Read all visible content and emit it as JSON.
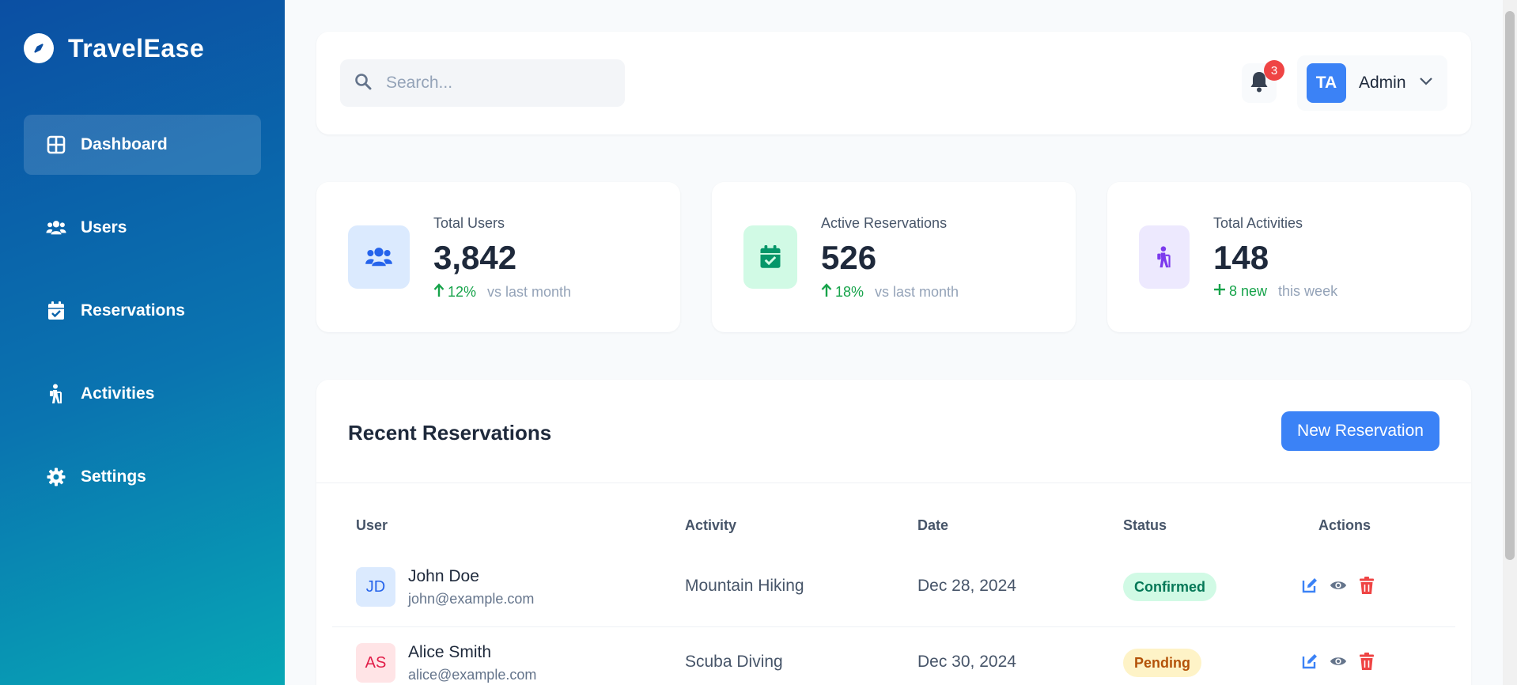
{
  "brand": {
    "name": "TravelEase",
    "icon": "compass-icon"
  },
  "sidebar": {
    "items": [
      {
        "label": "Dashboard",
        "icon": "dashboard-grid-icon",
        "active": true
      },
      {
        "label": "Users",
        "icon": "users-icon"
      },
      {
        "label": "Reservations",
        "icon": "calendar-check-icon"
      },
      {
        "label": "Activities",
        "icon": "hiking-icon"
      },
      {
        "label": "Settings",
        "icon": "gear-icon"
      }
    ]
  },
  "header": {
    "search": {
      "placeholder": "Search...",
      "value": ""
    },
    "notifications": {
      "count": "3",
      "icon": "bell-icon"
    },
    "user": {
      "initials": "TA",
      "name": "Admin"
    }
  },
  "stats": [
    {
      "label": "Total Users",
      "value": "3,842",
      "trend": "12%",
      "note": "vs last month",
      "icon": "users-icon"
    },
    {
      "label": "Active Reservations",
      "value": "526",
      "trend": "18%",
      "note": "vs last month",
      "icon": "calendar-check-icon"
    },
    {
      "label": "Total Activities",
      "value": "148",
      "trend": "8 new",
      "note": "this week",
      "icon": "hiking-icon"
    }
  ],
  "reservations": {
    "title": "Recent Reservations",
    "new_button": "New Reservation",
    "columns": [
      "User",
      "Activity",
      "Date",
      "Status",
      "Actions"
    ],
    "rows": [
      {
        "initials": "JD",
        "name": "John Doe",
        "email": "john@example.com",
        "activity": "Mountain Hiking",
        "date": "Dec 28, 2024",
        "status": "Confirmed"
      },
      {
        "initials": "AS",
        "name": "Alice Smith",
        "email": "alice@example.com",
        "activity": "Scuba Diving",
        "date": "Dec 30, 2024",
        "status": "Pending"
      }
    ]
  },
  "colors": {
    "primary": "#3b82f6",
    "sidebar_start": "#0b4fa3",
    "sidebar_end": "#07a7b5",
    "success": "#16a34a",
    "danger": "#ef4444",
    "pending_bg": "#fef3c7",
    "confirmed_bg": "#d1fae5"
  }
}
